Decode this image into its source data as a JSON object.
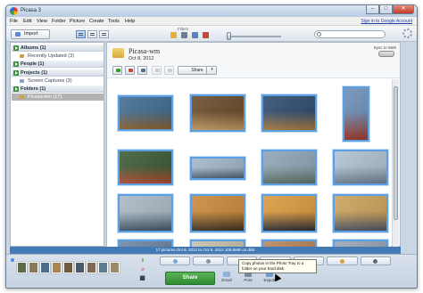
{
  "window": {
    "title": "Picasa 3",
    "minimize": "–",
    "maximize": "□",
    "close": "✕"
  },
  "menu": {
    "items": [
      "File",
      "Edit",
      "View",
      "Folder",
      "Picture",
      "Create",
      "Tools",
      "Help"
    ],
    "account_link": "Sign in to Google Account"
  },
  "toolbar": {
    "import_label": "Import",
    "filters_label": "Filters",
    "filter_icons": [
      "star-icon",
      "film-icon",
      "person-icon",
      "pin-icon"
    ],
    "search_placeholder": ""
  },
  "left_panel": {
    "sections": [
      {
        "label": "Albums (1)",
        "children": [
          "Recently Updated (3)"
        ]
      },
      {
        "label": "People (1)",
        "children": []
      },
      {
        "label": "Projects (1)",
        "children": [
          "Screen Captures (3)"
        ]
      },
      {
        "label": "Folders (1)",
        "children": [
          "Picasa-wm (17)"
        ]
      }
    ]
  },
  "album": {
    "title": "Picasa-wm",
    "date": "Oct 8, 2012",
    "sync_label": "Sync to Web",
    "share_label": "Share",
    "share_arrow": "▾"
  },
  "photos": [
    {
      "colors": [
        "#3f6b8f",
        "#8a5d2b"
      ],
      "selected": true
    },
    {
      "colors": [
        "#6a4a2a",
        "#c49860"
      ],
      "selected": true
    },
    {
      "colors": [
        "#2f4a6e",
        "#a77b3c"
      ],
      "selected": true
    },
    {
      "colors": [
        "#6c8db7",
        "#a03a2a"
      ],
      "selected": true
    },
    {
      "colors": [
        "#3a5a34",
        "#b04a30"
      ],
      "selected": true
    },
    {
      "colors": [
        "#a2b6c8",
        "#4b5f72"
      ],
      "selected": true
    },
    {
      "colors": [
        "#8fa4b5",
        "#5a6f64"
      ],
      "selected": true
    },
    {
      "colors": [
        "#b0c1d1",
        "#6c7e90"
      ],
      "selected": true
    },
    {
      "colors": [
        "#a9b8c4",
        "#3f5466"
      ],
      "selected": true
    },
    {
      "colors": [
        "#c8883a",
        "#3a3020"
      ],
      "selected": true
    },
    {
      "colors": [
        "#d99a3d",
        "#2b2a35"
      ],
      "selected": true
    },
    {
      "colors": [
        "#caa15a",
        "#4c5260"
      ],
      "selected": true
    },
    {
      "colors": [
        "#6f86a3",
        "#3a4552"
      ],
      "selected": true
    },
    {
      "colors": [
        "#c7c0ae",
        "#8e7c62"
      ],
      "selected": true
    },
    {
      "colors": [
        "#b9865a",
        "#475465"
      ],
      "selected": true
    },
    {
      "colors": [
        "#9aa6b4",
        "#5c6674"
      ],
      "selected": true
    },
    {
      "colors": [
        "#b5b0a8",
        "#6a625a"
      ],
      "selected": true
    }
  ],
  "status": {
    "text": "17 pictures    Oct 8, 2012 to Oct 8, 2012    108.6MB on disk"
  },
  "tray": {
    "share_button": "Share",
    "actions": [
      "Email",
      "Print",
      "Export"
    ],
    "tooltip": "Copy photos in the Photo Tray to a folder on your hard disk",
    "tools": [
      "⬆",
      "⊘",
      "⬛"
    ],
    "tray_thumb_colors": [
      "#5d6b4a",
      "#8b7a5a",
      "#4e6b88",
      "#a88452",
      "#6d5a3f",
      "#4a5a6e",
      "#7c6a52",
      "#5f7d92",
      "#9b8a6a"
    ]
  }
}
